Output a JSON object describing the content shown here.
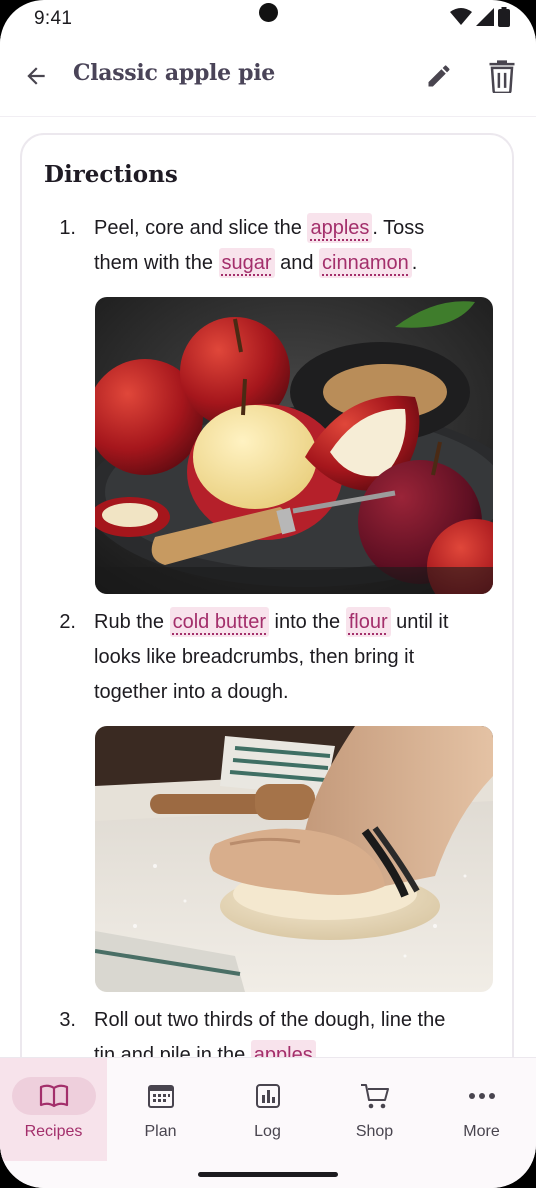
{
  "status": {
    "time": "9:41"
  },
  "app_bar": {
    "title": "Classic apple pie"
  },
  "card": {
    "title": "Directions",
    "steps": [
      {
        "number": "1.",
        "lines": [
          [
            {
              "t": "Peel, core and slice the "
            },
            {
              "c": "apples"
            },
            {
              "t": ". Toss"
            }
          ],
          [
            {
              "t": "them with the "
            },
            {
              "c": "sugar"
            },
            {
              "t": " and "
            },
            {
              "c": "cinnamon"
            },
            {
              "t": "."
            }
          ]
        ]
      },
      {
        "number": "2.",
        "lines": [
          [
            {
              "t": "Rub the "
            },
            {
              "c": "cold butter"
            },
            {
              "t": " into the "
            },
            {
              "c": "flour"
            },
            {
              "t": " until it"
            }
          ],
          [
            {
              "t": "looks like breadcrumbs, then bring it"
            }
          ],
          [
            {
              "t": "together into a dough."
            }
          ]
        ]
      },
      {
        "number": "3.",
        "lines": [
          [
            {
              "t": "Roll out two thirds of the dough, line the"
            }
          ],
          [
            {
              "t": "tin and pile in the "
            },
            {
              "c": "apples"
            }
          ]
        ]
      }
    ]
  },
  "bottom_nav": {
    "items": [
      {
        "label": "Recipes",
        "icon": "book-icon",
        "active": true
      },
      {
        "label": "Plan",
        "icon": "calendar-icon",
        "active": false
      },
      {
        "label": "Log",
        "icon": "chart-icon",
        "active": false
      },
      {
        "label": "Shop",
        "icon": "cart-icon",
        "active": false
      },
      {
        "label": "More",
        "icon": "more-icon",
        "active": false
      }
    ]
  },
  "colors": {
    "accent": "#a32f6b",
    "chip_bg": "#f8e3ec",
    "active_nav_bg": "#f7e3eb"
  }
}
